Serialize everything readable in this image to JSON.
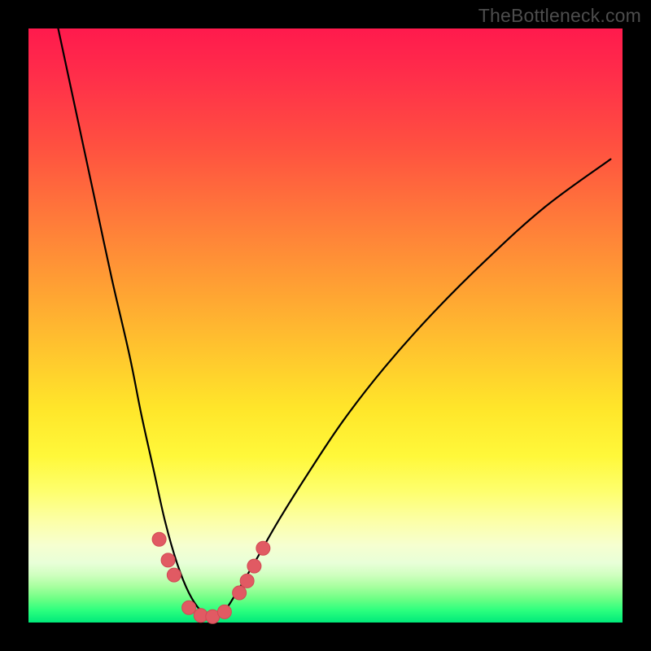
{
  "watermark": "TheBottleneck.com",
  "colors": {
    "frame": "#000000",
    "curve": "#000000",
    "marker_fill": "#e15a63",
    "marker_stroke": "#d24a54",
    "gradient_top": "#ff1a4d",
    "gradient_bottom": "#00e97a"
  },
  "chart_data": {
    "type": "line",
    "title": "",
    "xlabel": "",
    "ylabel": "",
    "xlim": [
      0,
      100
    ],
    "ylim": [
      0,
      100
    ],
    "note": "V-shaped bottleneck curve; y≈0 (green) near x≈27–33, rising toward 100 (red) at the edges. Right branch shallower than left.",
    "series": [
      {
        "name": "bottleneck-curve",
        "x": [
          5,
          8,
          11,
          14,
          17,
          19,
          21,
          23,
          25,
          27,
          29,
          31,
          33,
          35,
          38,
          42,
          47,
          53,
          60,
          68,
          77,
          87,
          98
        ],
        "values": [
          100,
          86,
          72,
          58,
          45,
          35,
          26,
          17,
          10,
          5,
          2,
          1,
          2,
          5,
          10,
          17,
          25,
          34,
          43,
          52,
          61,
          70,
          78
        ]
      }
    ],
    "markers": {
      "name": "highlighted-points",
      "x": [
        22.0,
        23.5,
        24.5,
        27.0,
        29.0,
        31.0,
        33.0,
        35.5,
        36.8,
        38.0,
        39.5
      ],
      "values": [
        14.0,
        10.5,
        8.0,
        2.5,
        1.2,
        1.0,
        1.8,
        5.0,
        7.0,
        9.5,
        12.5
      ]
    }
  }
}
